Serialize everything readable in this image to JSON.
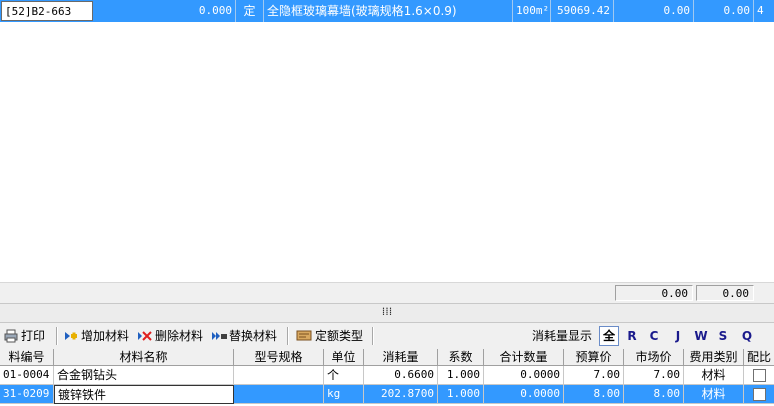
{
  "top_row": {
    "code": "[52]B2-663",
    "amount": "0.000",
    "type": "定",
    "name": "全隐框玻璃幕墙(玻璃规格1.6×0.9)",
    "unit": "100m²",
    "price": "59069.42",
    "v1": "0.00",
    "v2": "0.00",
    "v3": "4"
  },
  "summary": {
    "left": "0.00",
    "right": "0.00"
  },
  "splitter": {
    "grip": "⁞⁞⁞"
  },
  "toolbar": {
    "print": "打印",
    "add": "增加材料",
    "delete": "删除材料",
    "replace": "替换材料",
    "quota_type": "定额类型",
    "consumption_label": "消耗量显示",
    "letters": [
      "全",
      "R",
      "C",
      "J",
      "W",
      "S",
      "Q"
    ]
  },
  "table": {
    "headers": [
      "料编号",
      "材料名称",
      "型号规格",
      "单位",
      "消耗量",
      "系数",
      "合计数量",
      "预算价",
      "市场价",
      "费用类别",
      "配比"
    ],
    "rows": [
      {
        "code": "01-0004",
        "name": "合金钢钻头",
        "spec": "",
        "unit": "个",
        "consumption": "0.6600",
        "coef": "1.000",
        "total": "0.0000",
        "budget": "7.00",
        "market": "7.00",
        "category": "材料"
      },
      {
        "code": "31-0209",
        "name": "镀锌铁件",
        "spec": "",
        "unit": "kg",
        "consumption": "202.8700",
        "coef": "1.000",
        "total": "0.0000",
        "budget": "8.00",
        "market": "8.00",
        "category": "材料"
      }
    ]
  },
  "colors": {
    "selection": "#3399ff",
    "panel": "#f0f0f0"
  }
}
